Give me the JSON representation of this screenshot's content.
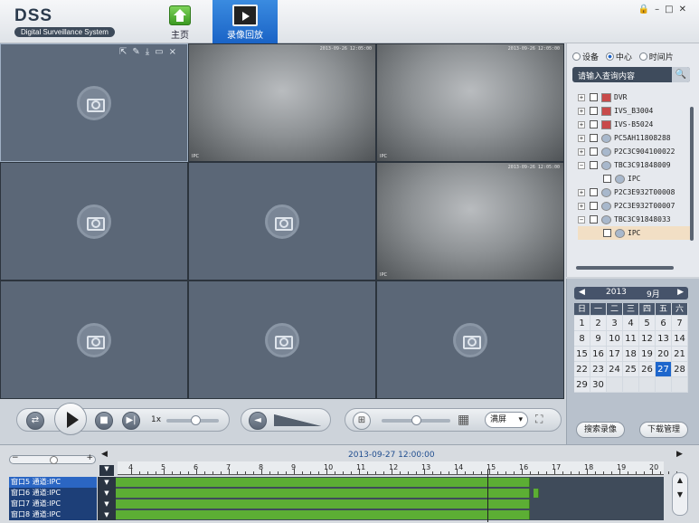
{
  "header": {
    "logo_title": "DSS",
    "logo_subtitle": "Digital Surveillance System",
    "tabs": [
      {
        "label": "主页",
        "icon": "home-icon"
      },
      {
        "label": "录像回放",
        "icon": "playback-icon"
      }
    ],
    "window_controls": [
      "lock-icon",
      "minimize-icon",
      "maximize-icon",
      "close-icon"
    ]
  },
  "video_grid": {
    "layout": "3x3",
    "timestamp": "2013-09-26 12:05:00",
    "channel_tag": "IPC"
  },
  "source_panel": {
    "modes": [
      {
        "label": "设备",
        "selected": false
      },
      {
        "label": "中心",
        "selected": true
      },
      {
        "label": "时间片",
        "selected": false
      }
    ],
    "search_placeholder": "请输入查询内容",
    "tree": [
      {
        "label": "DVR",
        "expander": "+"
      },
      {
        "label": "IVS_B3004",
        "expander": "+"
      },
      {
        "label": "IVS-B5024",
        "expander": "+"
      },
      {
        "label": "PC5AH11808288",
        "expander": "+"
      },
      {
        "label": "P2C3C904100022",
        "expander": "+"
      },
      {
        "label": "TBC3C91848009",
        "expander": "−"
      },
      {
        "label": "IPC",
        "child": true
      },
      {
        "label": "P2C3E932T00008",
        "expander": "+"
      },
      {
        "label": "P2C3E932T00007",
        "expander": "+"
      },
      {
        "label": "TBC3C91848033",
        "expander": "−"
      },
      {
        "label": "IPC",
        "child": true,
        "highlighted": true
      }
    ]
  },
  "calendar": {
    "year": "2013",
    "month": "9月",
    "weekdays": [
      "日",
      "一",
      "二",
      "三",
      "四",
      "五",
      "六"
    ],
    "days": [
      "1",
      "2",
      "3",
      "4",
      "5",
      "6",
      "7",
      "8",
      "9",
      "10",
      "11",
      "12",
      "13",
      "14",
      "15",
      "16",
      "17",
      "18",
      "19",
      "20",
      "21",
      "22",
      "23",
      "24",
      "25",
      "26",
      "27",
      "28",
      "29",
      "30"
    ],
    "selected_day": "27",
    "search_button": "搜索录像",
    "download_button": "下载管理"
  },
  "controls": {
    "speed": "1x",
    "split_label": "满屏",
    "speed_slider": 0.55,
    "volume_slider": 0.0,
    "zoom_slider": 0.5
  },
  "timeline": {
    "date": "2013-09-27 12:00:00",
    "hours": [
      "4",
      "5",
      "6",
      "7",
      "8",
      "9",
      "10",
      "11",
      "12",
      "13",
      "14",
      "15",
      "16",
      "17",
      "18",
      "19",
      "20"
    ],
    "rows": [
      {
        "label": "窗口5 通道:IPC",
        "selected": true
      },
      {
        "label": "窗口6 通道:IPC",
        "selected": false
      },
      {
        "label": "窗口7 通道:IPC",
        "selected": false
      },
      {
        "label": "窗口8 通道:IPC",
        "selected": false
      }
    ]
  }
}
